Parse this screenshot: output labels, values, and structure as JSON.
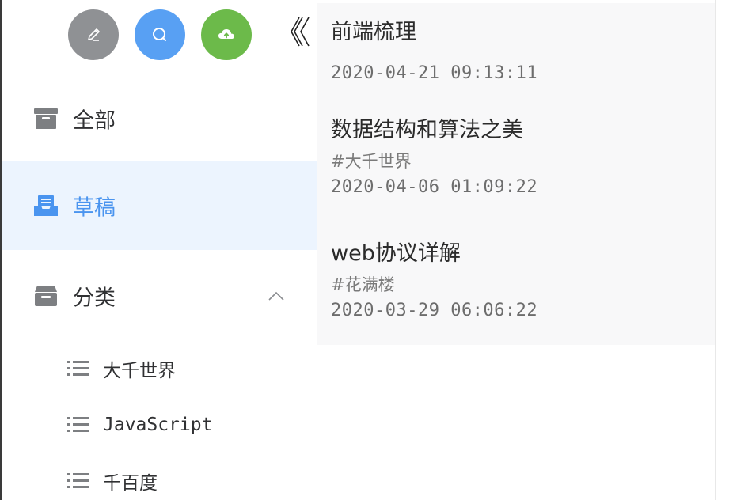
{
  "toolbar": {
    "buttons": [
      {
        "icon": "pencil-icon",
        "color": "#8f9194"
      },
      {
        "icon": "search-icon",
        "color": "#58a0f3"
      },
      {
        "icon": "cloud-upload-icon",
        "color": "#6cba4a"
      }
    ],
    "collapse_glyph": "《"
  },
  "sidebar": {
    "items": [
      {
        "label": "全部",
        "icon": "archive-icon"
      },
      {
        "label": "草稿",
        "icon": "inbox-icon",
        "active": true
      },
      {
        "label": "分类",
        "icon": "drawer-icon",
        "expanded": true
      }
    ],
    "categories": [
      {
        "label": "大千世界",
        "icon": "list-icon"
      },
      {
        "label": "JavaScript",
        "icon": "list-icon"
      },
      {
        "label": "千百度",
        "icon": "list-icon"
      }
    ]
  },
  "posts": [
    {
      "title": "前端梳理",
      "tag": "",
      "date": "2020-04-21 09:13:11"
    },
    {
      "title": "数据结构和算法之美",
      "tag": "#大千世界",
      "date": "2020-04-06 01:09:22"
    },
    {
      "title": "web协议详解",
      "tag": "#花满楼",
      "date": "2020-03-29 06:06:22"
    }
  ],
  "colors": {
    "accent": "#4a94ef",
    "active_bg": "#ecf4fe",
    "list_bg": "#f8f8f9"
  }
}
